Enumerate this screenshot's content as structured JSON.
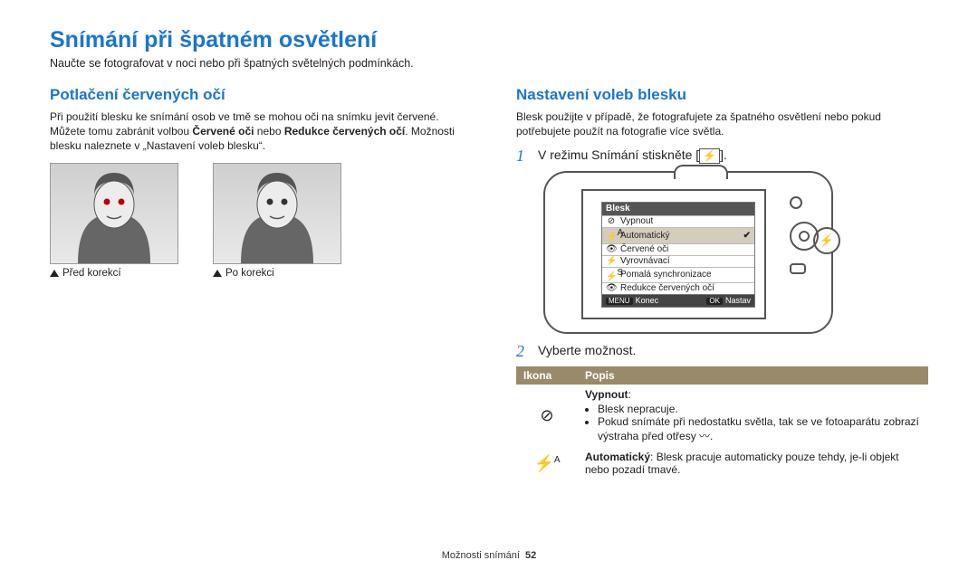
{
  "page_title": "Snímání při špatném osvětlení",
  "intro": "Naučte se fotografovat v noci nebo při špatných světelných podmínkách.",
  "left": {
    "heading": "Potlačení červených očí",
    "body_pre": "Při použití blesku ke snímání osob ve tmě se mohou oči na snímku jevit červené. Můžete tomu zabránit volbou ",
    "bold1": "Červené oči",
    "mid": " nebo ",
    "bold2": "Redukce červených očí",
    "body_post": ". Možnosti blesku naleznete v „Nastavení voleb blesku“.",
    "caption_before": "Před korekcí",
    "caption_after": "Po korekci"
  },
  "right": {
    "heading": "Nastavení voleb blesku",
    "body": "Blesk použijte v případě, že fotografujete za špatného osvětlení nebo pokud potřebujete použít na fotografie více světla.",
    "step1_pre": "V režimu Snímání stiskněte [",
    "step1_post": "].",
    "flash_glyph": "⚡",
    "step2": "Vyberte možnost.",
    "menu": {
      "title": "Blesk",
      "items": [
        {
          "icon": "⊘",
          "label": "Vypnout"
        },
        {
          "icon": "⚡",
          "sup": "A",
          "label": "Automatický",
          "selected": true
        },
        {
          "icon": "👁",
          "label": "Červené oči"
        },
        {
          "icon": "⚡",
          "label": "Vyrovnávací"
        },
        {
          "icon": "⚡",
          "sup": "S",
          "label": "Pomalá synchronizace"
        },
        {
          "icon": "👁",
          "label": "Redukce červených očí"
        }
      ],
      "footer_left_btn": "MENU",
      "footer_left": "Konec",
      "footer_right_btn": "OK",
      "footer_right": "Nastav"
    },
    "table": {
      "h_icon": "Ikona",
      "h_desc": "Popis",
      "rows": [
        {
          "icon": "⊘",
          "title": "Vypnout",
          "title_suffix": ":",
          "bullets": [
            "Blesk nepracuje.",
            "Pokud snímáte při nedostatku světla, tak se ve fotoaparátu zobrazí výstraha před otřesy 〰."
          ]
        },
        {
          "icon": "⚡",
          "icon_sup": "A",
          "title": "Automatický",
          "title_suffix": ": ",
          "rest": "Blesk pracuje automaticky pouze tehdy, je-li objekt nebo pozadí tmavé."
        }
      ]
    }
  },
  "footer": {
    "section": "Možnosti snímání",
    "page": "52"
  }
}
